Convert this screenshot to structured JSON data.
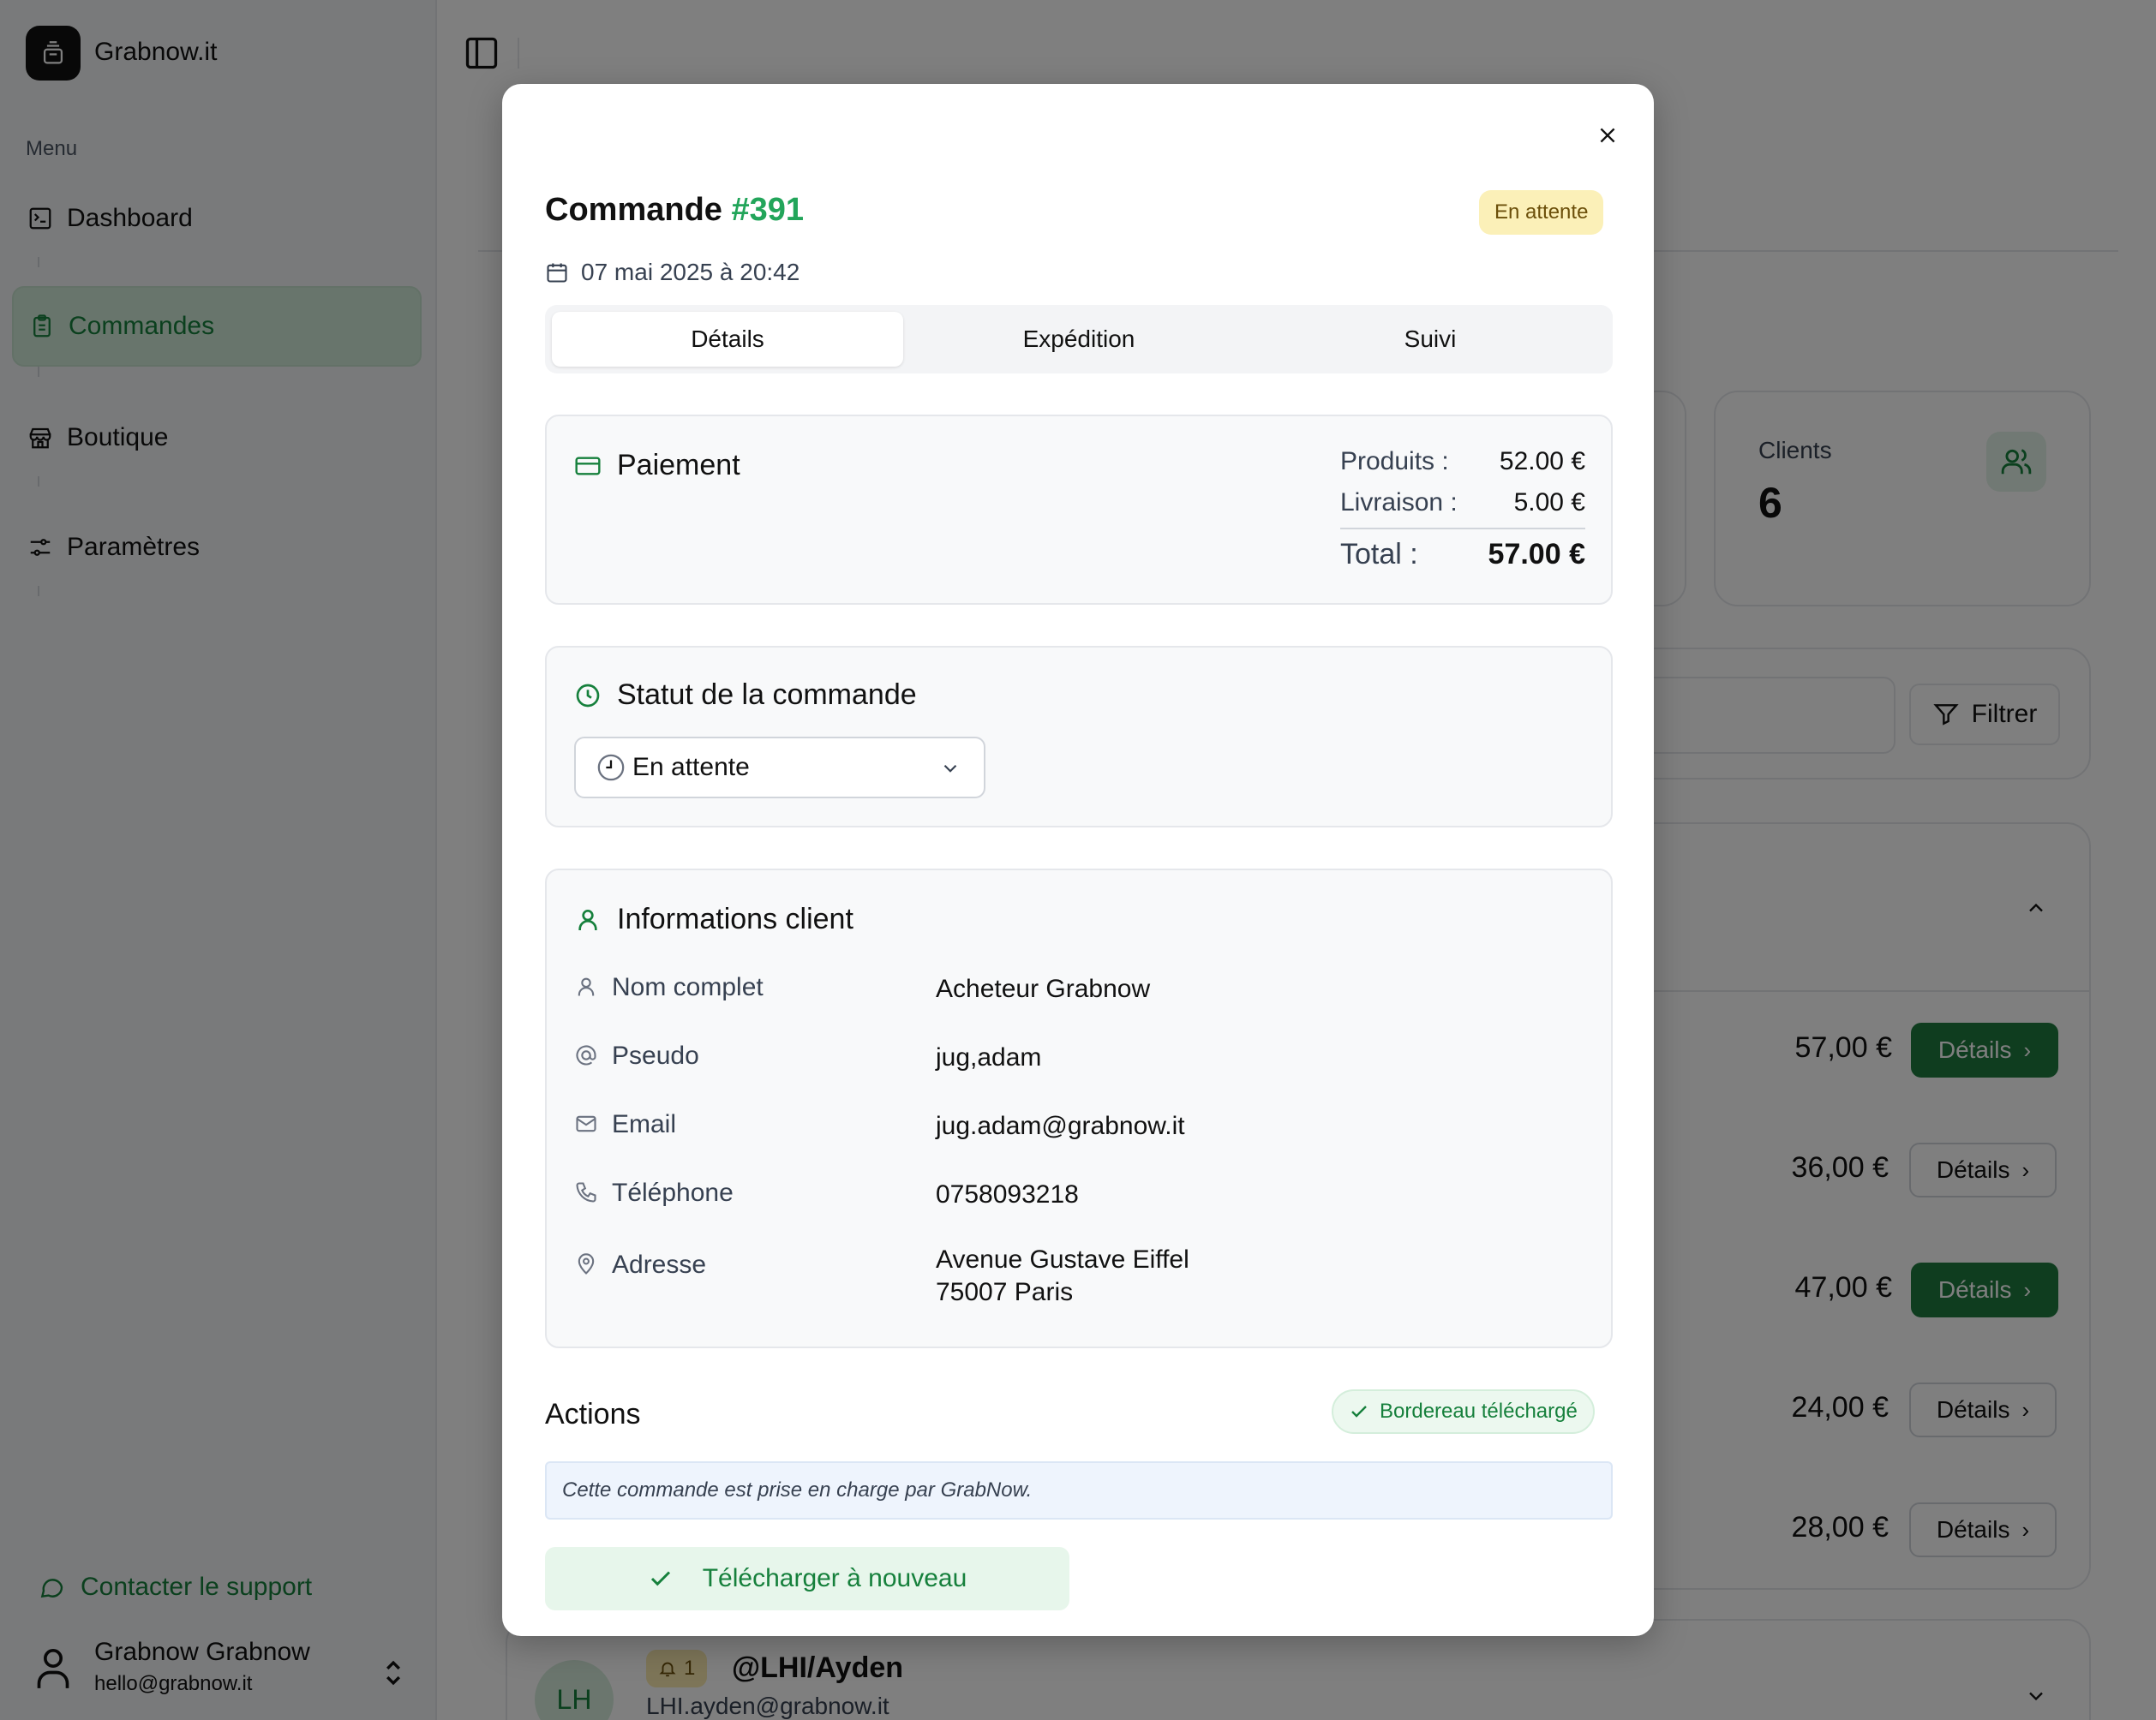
{
  "app": {
    "brand": "Grabnow.it"
  },
  "sidebar": {
    "menu_label": "Menu",
    "items": [
      {
        "label": "Dashboard",
        "icon": "dashboard-icon"
      },
      {
        "label": "Commandes",
        "icon": "clipboard-icon",
        "active": true
      },
      {
        "label": "Boutique",
        "icon": "store-icon"
      },
      {
        "label": "Paramètres",
        "icon": "settings-sliders-icon"
      }
    ],
    "support_label": "Contacter le support",
    "user": {
      "name": "Grabnow Grabnow",
      "email": "hello@grabnow.it"
    }
  },
  "background": {
    "stats": {
      "clients_label": "Clients",
      "clients_value": "6"
    },
    "filter_label": "Filtrer",
    "orders": [
      {
        "amount": "57,00 €",
        "button": "Détails",
        "highlight": true
      },
      {
        "amount": "36,00 €",
        "button": "Détails",
        "highlight": false
      },
      {
        "amount": "47,00 €",
        "button": "Détails",
        "highlight": true
      },
      {
        "amount": "24,00 €",
        "button": "Détails",
        "highlight": false
      },
      {
        "amount": "28,00 €",
        "button": "Détails",
        "highlight": false
      }
    ],
    "next_group": {
      "initials": "LH",
      "notif_count": "1",
      "handle": "@LHI/Ayden",
      "email": "LHI.ayden@grabnow.it"
    }
  },
  "modal": {
    "title_prefix": "Commande",
    "order_number": "#391",
    "status_badge": "En attente",
    "date": "07 mai 2025 à 20:42",
    "tabs": [
      {
        "label": "Détails",
        "active": true
      },
      {
        "label": "Expédition",
        "active": false
      },
      {
        "label": "Suivi",
        "active": false
      }
    ],
    "payment": {
      "title": "Paiement",
      "products_label": "Produits :",
      "products_value": "52.00 €",
      "shipping_label": "Livraison :",
      "shipping_value": "5.00 €",
      "total_label": "Total :",
      "total_value": "57.00 €"
    },
    "status": {
      "title": "Statut de la commande",
      "selected": "En attente"
    },
    "client": {
      "title": "Informations client",
      "rows": [
        {
          "icon": "user-icon",
          "label": "Nom complet",
          "value": "Acheteur Grabnow"
        },
        {
          "icon": "at-sign-icon",
          "label": "Pseudo",
          "value": "jug,adam"
        },
        {
          "icon": "mail-icon",
          "label": "Email",
          "value": "jug.adam@grabnow.it"
        },
        {
          "icon": "phone-icon",
          "label": "Téléphone",
          "value": "0758093218"
        },
        {
          "icon": "map-pin-icon",
          "label": "Adresse",
          "value_line1": "Avenue Gustave Eiffel",
          "value_line2": "75007 Paris"
        }
      ]
    },
    "actions": {
      "title": "Actions",
      "badge": "Bordereau téléchargé",
      "note": "Cette commande est prise en charge par GrabNow.",
      "download_button": "Télécharger à nouveau"
    }
  },
  "colors": {
    "accent": "#16803c",
    "accent_light": "#22a55a",
    "warning_bg": "#fbf0b8"
  }
}
